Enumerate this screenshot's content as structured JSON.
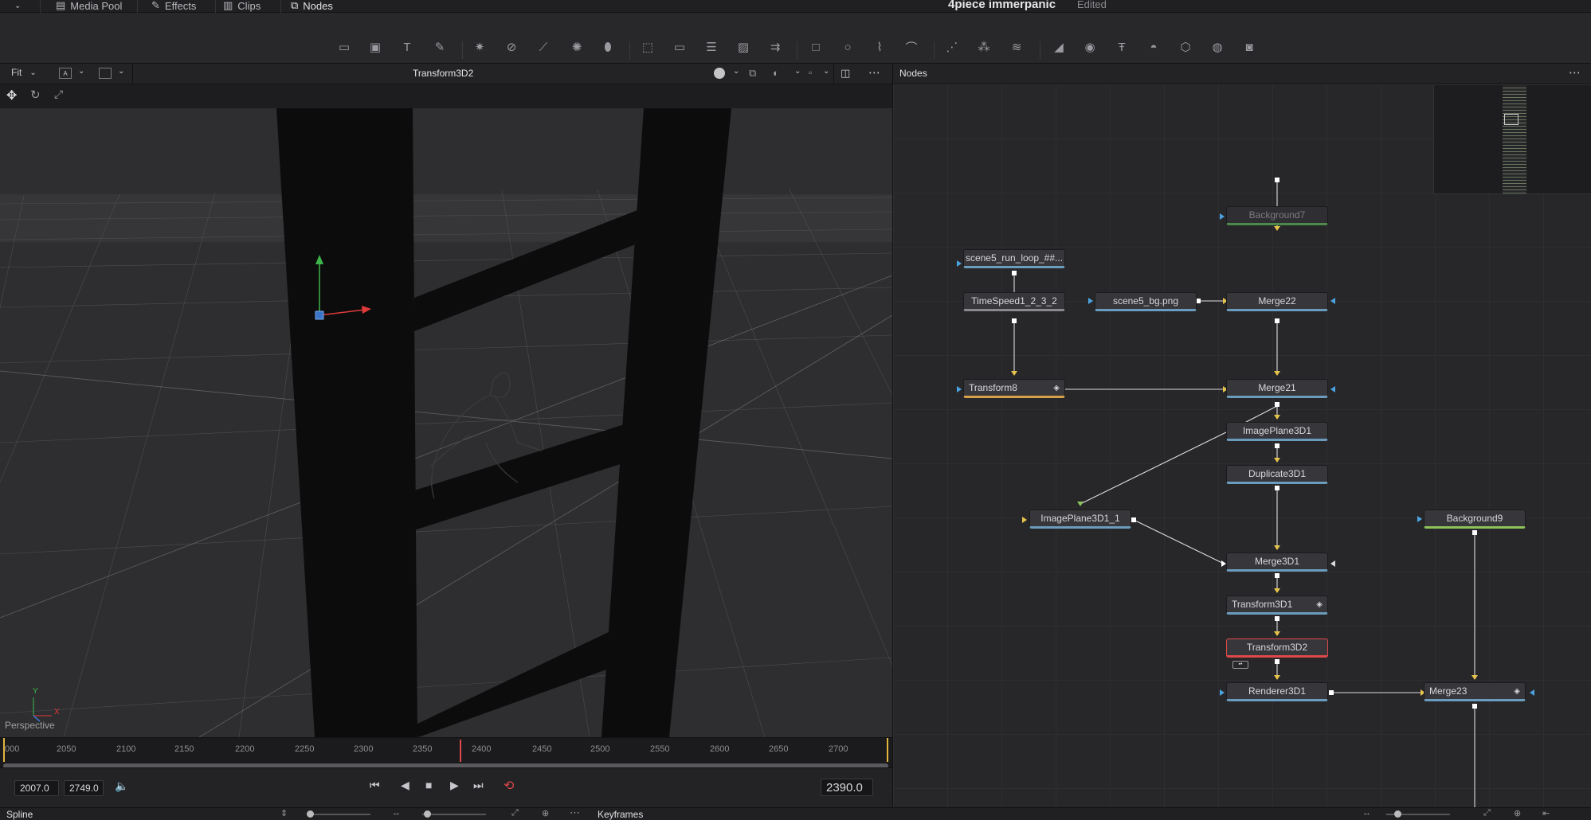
{
  "topbar": {
    "items": [
      "Media Pool",
      "Effects",
      "Clips",
      "Nodes"
    ],
    "project_title": "4piece immerpanic",
    "status": "Edited"
  },
  "viewer": {
    "zoom": "Fit",
    "node_name": "Transform3D2",
    "view_label": "Perspective",
    "axis_y": "Y",
    "axis_x": "X"
  },
  "timeline": {
    "ticks": [
      "000",
      "2050",
      "2100",
      "2150",
      "2200",
      "2250",
      "2300",
      "2350",
      "2400",
      "2450",
      "2500",
      "2550",
      "2600",
      "2650",
      "2700"
    ],
    "start": "2007.0",
    "end": "2749.0",
    "current": "2390.0"
  },
  "nodes_panel": {
    "title": "Nodes",
    "nodes": {
      "background7": "Background7",
      "scene5_run": "scene5_run_loop_##...",
      "timespeed": "TimeSpeed1_2_3_2",
      "scene5_bg": "scene5_bg.png",
      "merge22": "Merge22",
      "transform8": "Transform8",
      "merge21": "Merge21",
      "imageplane3d1": "ImagePlane3D1",
      "duplicate3d1": "Duplicate3D1",
      "imageplane3d1_1": "ImagePlane3D1_1",
      "background9": "Background9",
      "merge3d1": "Merge3D1",
      "transform3d1": "Transform3D1",
      "transform3d2": "Transform3D2",
      "renderer3d1": "Renderer3D1",
      "merge23": "Merge23"
    }
  },
  "bottombar": {
    "spline": "Spline",
    "keyframes": "Keyframes"
  },
  "colors": {
    "selected": "#e0484a",
    "link": "#d9d9d9",
    "input_arrow": "#e6c34a",
    "accent_blue": "#4aa3df"
  }
}
